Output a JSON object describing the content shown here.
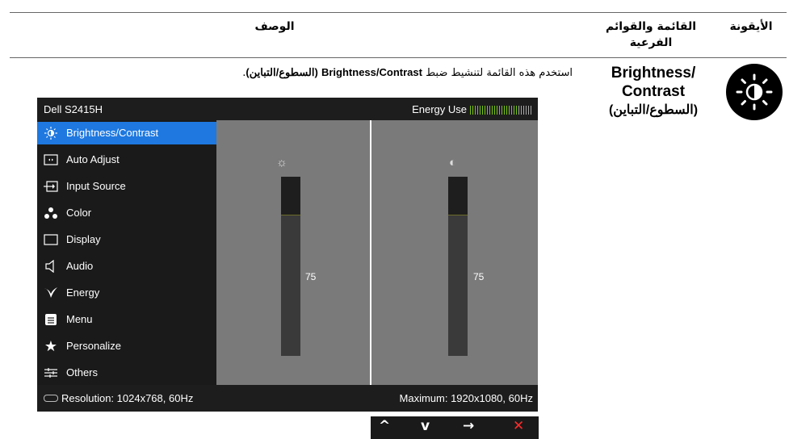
{
  "header": {
    "col_icon": "الأيقونة",
    "col_menu_line1": "القائمة والقوائم",
    "col_menu_line2": "الفرعية",
    "col_desc": "الوصف"
  },
  "row": {
    "icon": "brightness-icon",
    "menu_line1": "Brightness/",
    "menu_line2": "Contrast",
    "menu_line3": "(السطوع/التباين)",
    "desc_prefix": "استخدم هذه القائمة لتنشيط ضبط",
    "desc_bold": "Brightness/Contrast",
    "desc_bold_ar": "(السطوع/التباين)",
    "desc_end": "."
  },
  "osd": {
    "title": "Dell S2415H",
    "energy_label": "Energy Use",
    "energy_level": 0.77,
    "menu": [
      {
        "label": "Brightness/Contrast",
        "icon": "brightness-icon",
        "active": true
      },
      {
        "label": "Auto Adjust",
        "icon": "auto-adjust-icon"
      },
      {
        "label": "Input Source",
        "icon": "input-source-icon"
      },
      {
        "label": "Color",
        "icon": "color-icon"
      },
      {
        "label": "Display",
        "icon": "display-icon"
      },
      {
        "label": "Audio",
        "icon": "audio-icon"
      },
      {
        "label": "Energy",
        "icon": "energy-icon"
      },
      {
        "label": "Menu",
        "icon": "menu-icon"
      },
      {
        "label": "Personalize",
        "icon": "star-icon"
      },
      {
        "label": "Others",
        "icon": "others-icon"
      }
    ],
    "brightness_value": "75",
    "contrast_value": "75",
    "brightness_level": 75,
    "contrast_level": 75,
    "resolution": "Resolution: 1024x768, 60Hz",
    "maximum": "Maximum: 1920x1080, 60Hz",
    "accent": "#1e78e0",
    "energy_color": "#79c21a"
  },
  "nav_buttons": [
    "up-arrow-icon",
    "down-arrow-icon",
    "right-arrow-icon",
    "close-icon"
  ]
}
